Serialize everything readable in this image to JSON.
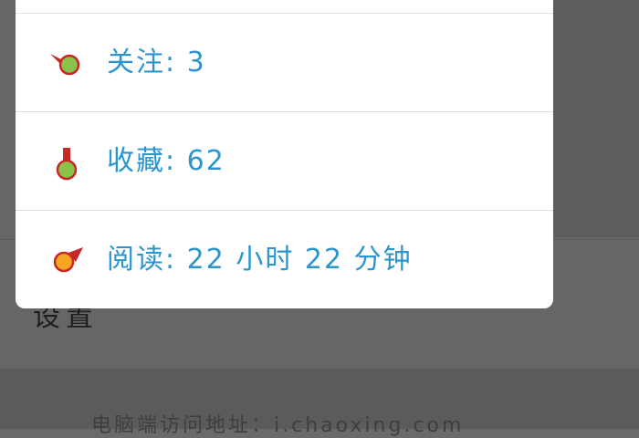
{
  "background": {
    "settings_label": "设置",
    "footer_text": "电脑端访问地址：i.chaoxing.com"
  },
  "popup": {
    "items": [
      {
        "icon": "follow-icon",
        "label": "关注: 3"
      },
      {
        "icon": "favorite-icon",
        "label": "收藏: 62"
      },
      {
        "icon": "reading-time-icon",
        "label": "阅读: 22 小时 22 分钟"
      }
    ]
  },
  "colors": {
    "label_text": "#2a95cf",
    "icon_green": "#8bc34a",
    "icon_orange": "#f5a623",
    "icon_red": "#c62828"
  }
}
